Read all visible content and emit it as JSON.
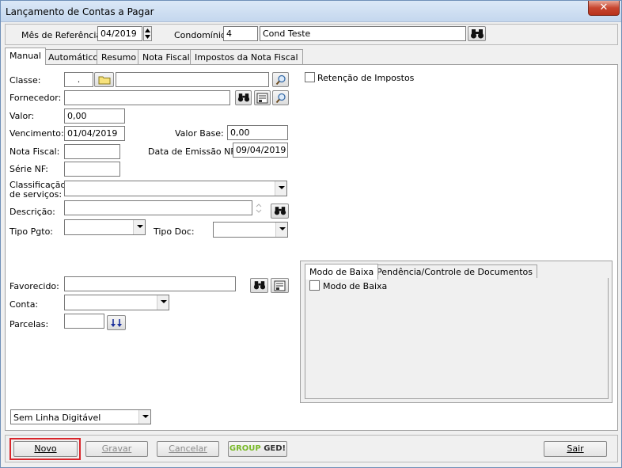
{
  "window": {
    "title": "Lançamento de Contas a Pagar",
    "close_label": "✕"
  },
  "header": {
    "mes_label": "Mês de Referência:",
    "mes_value": "04/2019",
    "condominio_label": "Condomínio:",
    "condominio_code": "4",
    "condominio_name": "Cond Teste"
  },
  "tabs": [
    {
      "label": "Manual"
    },
    {
      "label": "Automático"
    },
    {
      "label": "Resumo"
    },
    {
      "label": "Nota Fiscal"
    },
    {
      "label": "Impostos da Nota Fiscal"
    }
  ],
  "form": {
    "classe_label": "Classe:",
    "classe_value": ".",
    "fornecedor_label": "Fornecedor:",
    "valor_label": "Valor:",
    "valor_value": "0,00",
    "vencimento_label": "Vencimento:",
    "vencimento_value": "01/04/2019",
    "valor_base_label": "Valor Base:",
    "valor_base_value": "0,00",
    "nota_fiscal_label": "Nota Fiscal:",
    "data_emissao_label": "Data de Emissão NF:",
    "data_emissao_value": "09/04/2019",
    "serie_label": "Série NF:",
    "classificacao_label_1": "Classificação",
    "classificacao_label_2": "de serviços:",
    "descricao_label": "Descrição:",
    "tipo_pgto_label": "Tipo Pgto:",
    "tipo_doc_label": "Tipo Doc:",
    "favorecido_label": "Favorecido:",
    "conta_label": "Conta:",
    "parcelas_label": "Parcelas:",
    "retencao_label": "Retenção de Impostos",
    "linha_digitavel": "Sem Linha Digitável"
  },
  "subtabs": [
    {
      "label": "Modo de Baixa"
    },
    {
      "label": "Pendência/Controle de Documentos"
    }
  ],
  "modo_baixa_check": "Modo de Baixa",
  "buttons": {
    "novo": "Novo",
    "gravar": "Gravar",
    "cancelar": "Cancelar",
    "group_ged_1": "GROUP",
    "group_ged_2": "GED!",
    "sair": "Sair"
  },
  "colors": {
    "accent_highlight": "#d9262b",
    "titlebar": "#c4d7ee",
    "group_green": "#79b928"
  }
}
